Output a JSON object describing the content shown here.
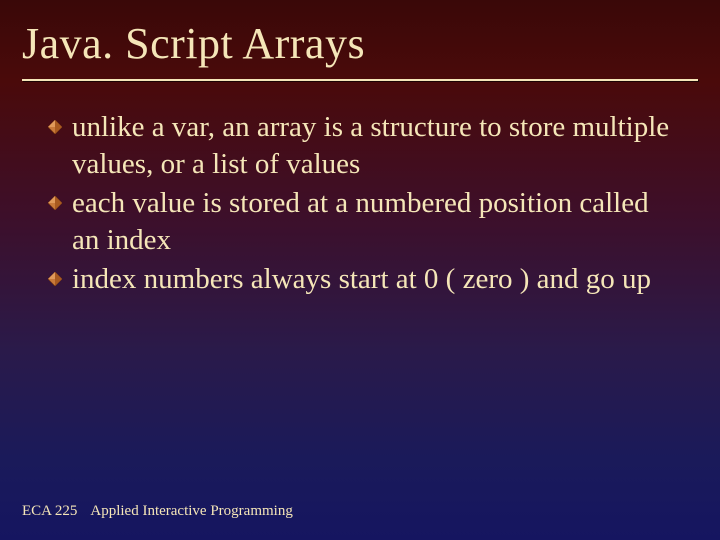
{
  "title": "Java. Script Arrays",
  "bullets": [
    "unlike a var, an array is a structure to store multiple values, or a list of values",
    "each value is stored at a numbered position called an index",
    "index numbers always start at 0 ( zero ) and go up"
  ],
  "footer": {
    "course": "ECA 225",
    "subtitle": "Applied Interactive Programming"
  },
  "colors": {
    "text": "#f5e6b8",
    "bulletFill": "#c97a3a"
  }
}
